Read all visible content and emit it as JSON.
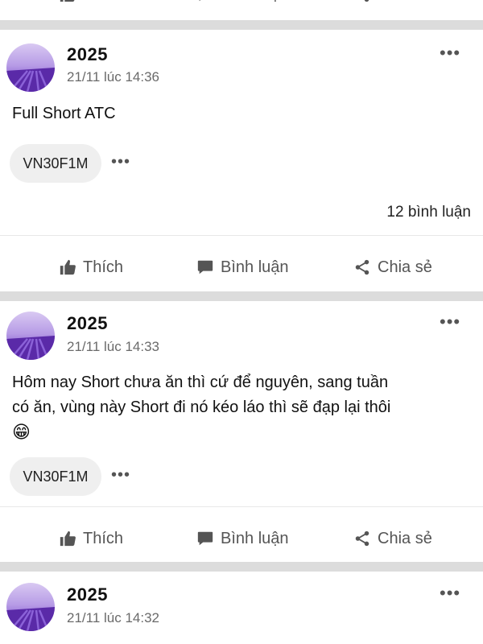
{
  "actions": {
    "like_label": "Thích",
    "comment_label": "Bình luận",
    "share_label": "Chia sẻ"
  },
  "posts": [
    {
      "author": "2025",
      "time": "21/11 lúc 14:36",
      "text": "Full Short ATC",
      "tag": "VN30F1M",
      "comments_count": "12 bình luận"
    },
    {
      "author": "2025",
      "time": "21/11 lúc 14:33",
      "text_line1": "Hôm nay Short chưa ăn thì cứ để nguyên, sang tuần",
      "text_line2": "có ăn, vùng này Short đi nó kéo láo thì sẽ đạp lại thôi",
      "emoji": "😁",
      "tag": "VN30F1M"
    },
    {
      "author": "2025",
      "time": "21/11 lúc 14:32"
    }
  ],
  "more_glyph": "•••",
  "colors": {
    "divider": "#dcdcdc",
    "chip_bg": "#efefef",
    "action_text": "#555555",
    "avatar_purple": "#7b4fc6"
  },
  "icons": {
    "like": "thumbs-up-icon",
    "comment": "speech-bubble-icon",
    "share": "share-icon",
    "more": "more-horizontal-icon"
  }
}
